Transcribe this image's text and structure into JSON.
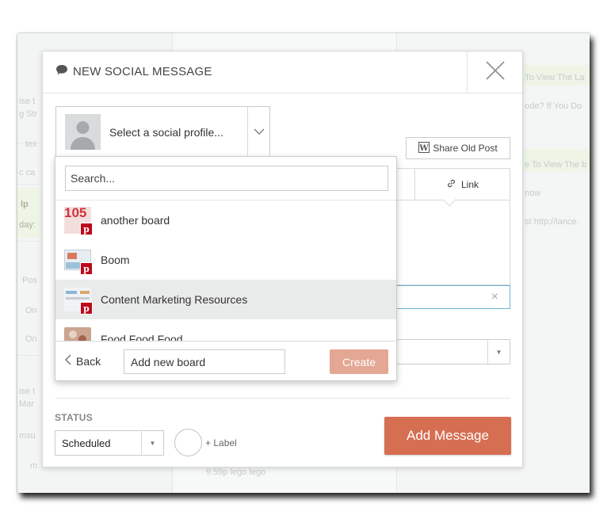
{
  "background": {
    "left_snippets": [
      "ise t",
      "g Str",
      "tex",
      "c ca",
      "lp",
      "day:",
      "Pos",
      "On",
      "On",
      "ise t",
      "Mar",
      "msu",
      "m"
    ],
    "mid_snippets": [
      "9:59p lego lego"
    ],
    "right_snippets": [
      "To View The La",
      "ode? If You Do",
      "e To View The b",
      "now",
      "st http://lance."
    ]
  },
  "modal": {
    "title": "NEW SOCIAL MESSAGE",
    "profile_select_label": "Select a social profile...",
    "share_old_post": "Share Old Post",
    "link_tab": "Link",
    "url_clear": "×",
    "status_label": "STATUS",
    "status_value": "Scheduled",
    "add_label": "+ Label",
    "add_message": "Add Message"
  },
  "dropdown": {
    "search_placeholder": "Search...",
    "items": [
      {
        "label": "another board",
        "thumb": "105"
      },
      {
        "label": "Boom",
        "thumb": ""
      },
      {
        "label": "Content Marketing Resources",
        "thumb": ""
      },
      {
        "label": "Food Food Food",
        "thumb": ""
      }
    ],
    "back_label": "Back",
    "new_board_placeholder": "Add new board",
    "create_label": "Create"
  },
  "colors": {
    "accent": "#d66e51",
    "accent_disabled": "#e4a794",
    "pinterest": "#bd081c",
    "focus_border": "#6fb2d1"
  },
  "icons": [
    "speech-bubble-icon",
    "close-icon",
    "chevron-down-icon",
    "wordpress-icon",
    "link-icon",
    "pinterest-icon",
    "chevron-left-icon"
  ]
}
